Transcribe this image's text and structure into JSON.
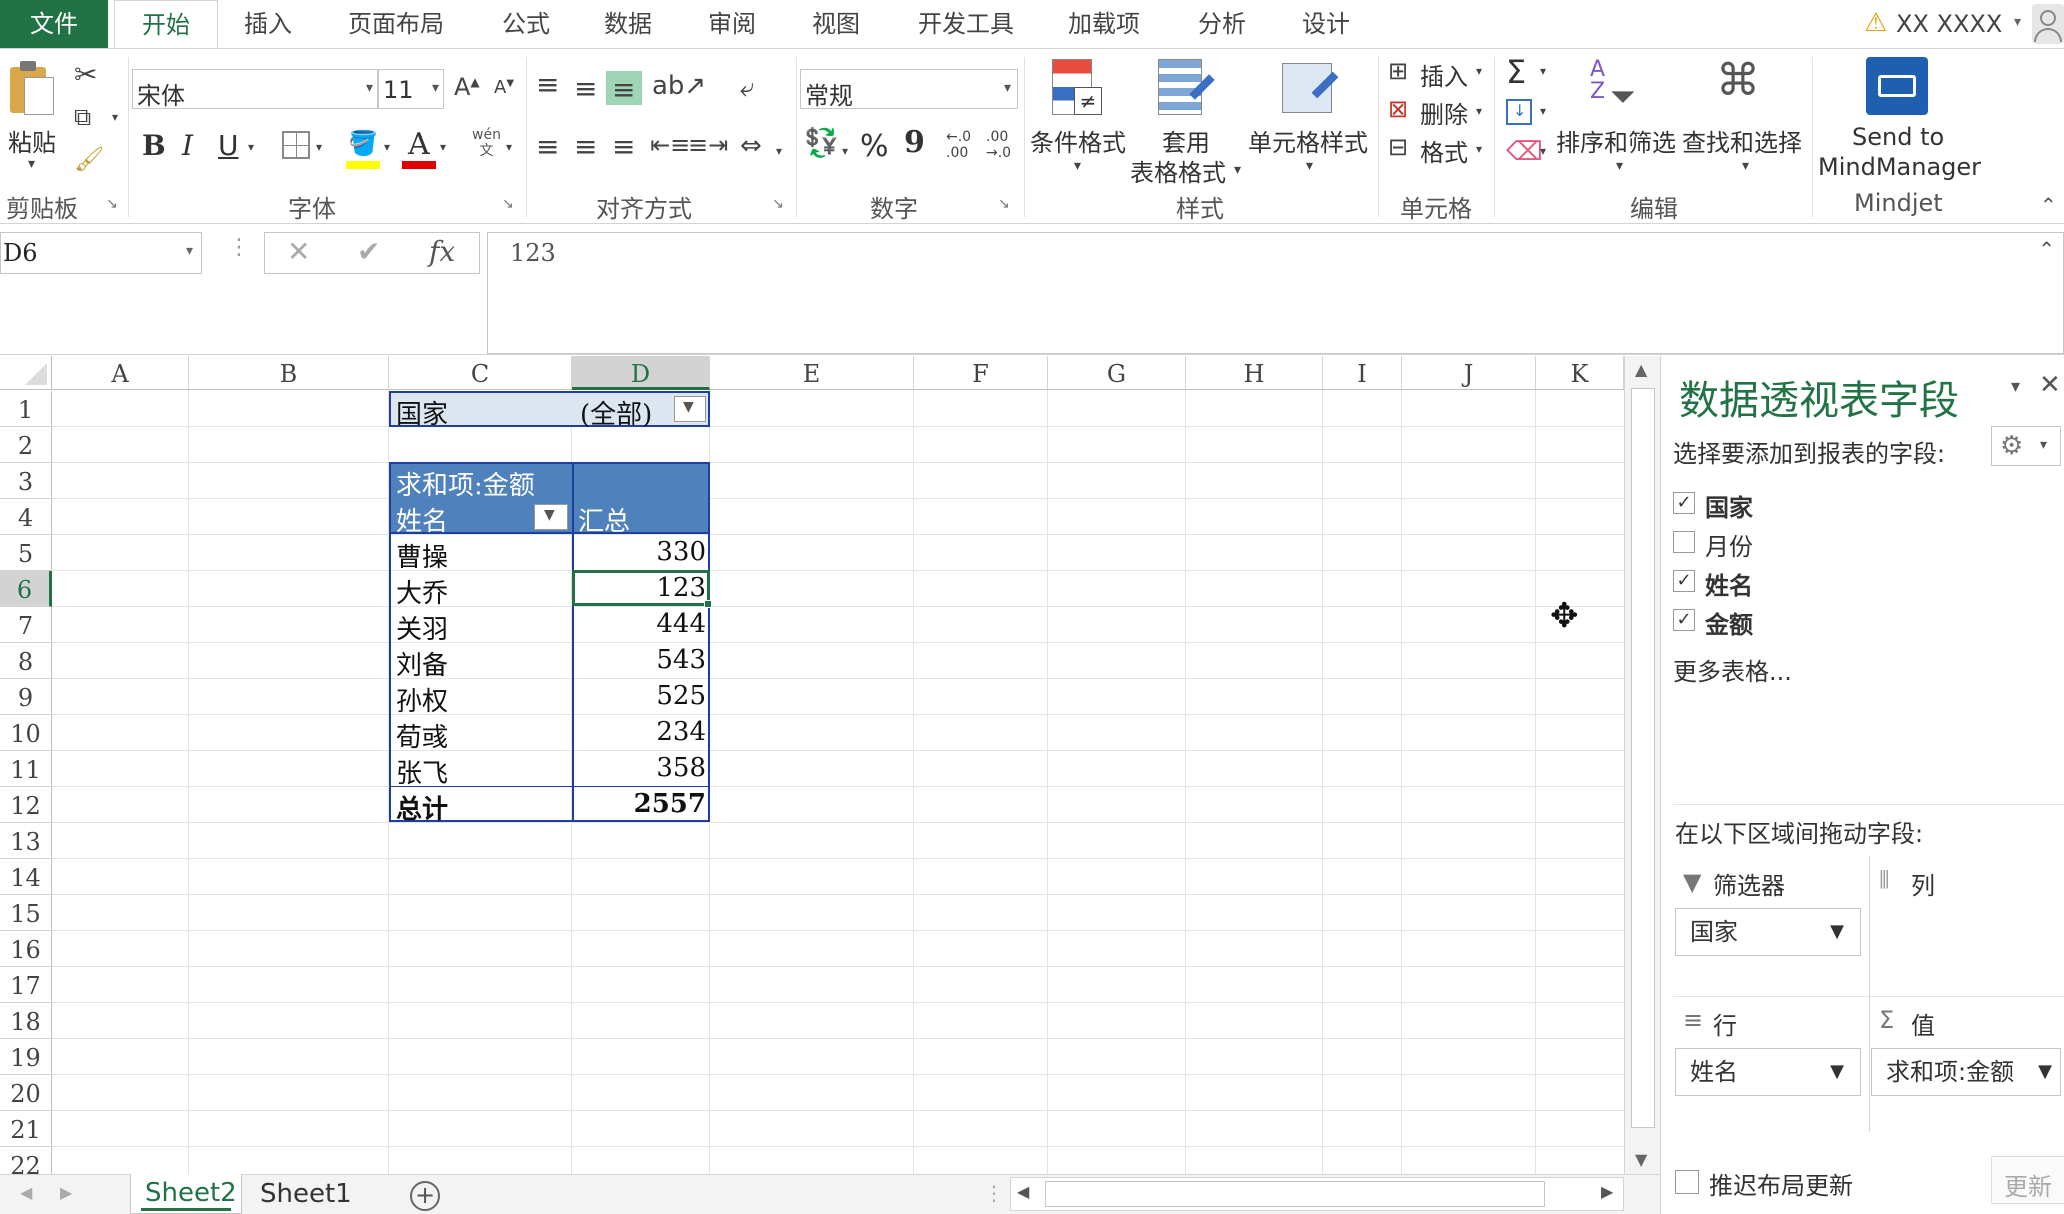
{
  "tabs": {
    "file": "文件",
    "items": [
      "开始",
      "插入",
      "页面布局",
      "公式",
      "数据",
      "审阅",
      "视图",
      "开发工具",
      "加载项",
      "分析",
      "设计"
    ],
    "user": "XX XXXX"
  },
  "ribbon": {
    "clipboard": {
      "paste": "粘贴",
      "label": "剪贴板"
    },
    "font": {
      "name": "宋体",
      "size": "11",
      "bold": "B",
      "italic": "I",
      "underline": "U",
      "label": "字体",
      "phonetic": "wén\n文"
    },
    "alignment": {
      "label": "对齐方式"
    },
    "number": {
      "format": "常规",
      "percent": "%",
      "comma": "9",
      "inc": "←.0\n.00",
      "dec": ".00\n→.0",
      "label": "数字"
    },
    "styles": {
      "conditional": "条件格式",
      "table_line1": "套用",
      "table_line2": "表格格式",
      "cell": "单元格样式",
      "label": "样式"
    },
    "cells": {
      "insert": "插入",
      "delete": "删除",
      "format": "格式",
      "label": "单元格"
    },
    "editing": {
      "sum": "Σ",
      "sort": "排序和筛选",
      "find": "查找和选择",
      "label": "编辑"
    },
    "mindjet": {
      "line1": "Send to",
      "line2": "MindManager",
      "label": "Mindjet"
    }
  },
  "formula_bar": {
    "name_box": "D6",
    "fx": "fx",
    "value": "123"
  },
  "grid": {
    "columns": [
      "A",
      "B",
      "C",
      "D",
      "E",
      "F",
      "G",
      "H",
      "I",
      "J",
      "K"
    ],
    "rows": [
      "1",
      "2",
      "3",
      "4",
      "5",
      "6",
      "7",
      "8",
      "9",
      "10",
      "11",
      "12",
      "13",
      "14",
      "15",
      "16",
      "17",
      "18",
      "19",
      "20",
      "21",
      "22"
    ],
    "filter_label": "国家",
    "filter_value": "(全部)",
    "pivot_title": "求和项:金额",
    "row_header": "姓名",
    "col_header": "汇总",
    "records": [
      {
        "name": "曹操",
        "value": "330"
      },
      {
        "name": "大乔",
        "value": "123"
      },
      {
        "name": "关羽",
        "value": "444"
      },
      {
        "name": "刘备",
        "value": "543"
      },
      {
        "name": "孙权",
        "value": "525"
      },
      {
        "name": "荀彧",
        "value": "234"
      },
      {
        "name": "张飞",
        "value": "358"
      }
    ],
    "total_label": "总计",
    "total_value": "2557"
  },
  "pane": {
    "title": "数据透视表字段",
    "subtitle": "选择要添加到报表的字段:",
    "fields": [
      {
        "name": "国家",
        "checked": true
      },
      {
        "name": "月份",
        "checked": false
      },
      {
        "name": "姓名",
        "checked": true
      },
      {
        "name": "金额",
        "checked": true
      }
    ],
    "more": "更多表格...",
    "drag_label": "在以下区域间拖动字段:",
    "filters_label": "筛选器",
    "filters_value": "国家",
    "columns_label": "列",
    "rows_label": "行",
    "rows_value": "姓名",
    "values_label": "值",
    "values_value": "求和项:金额",
    "defer": "推迟布局更新",
    "update": "更新"
  },
  "sheets": [
    "Sheet2",
    "Sheet1"
  ],
  "colors": {
    "excel_green": "#217346",
    "pivot_blue": "#4f81bd",
    "pivot_light": "#dce6f1",
    "pivot_border": "#1f3fa0"
  }
}
